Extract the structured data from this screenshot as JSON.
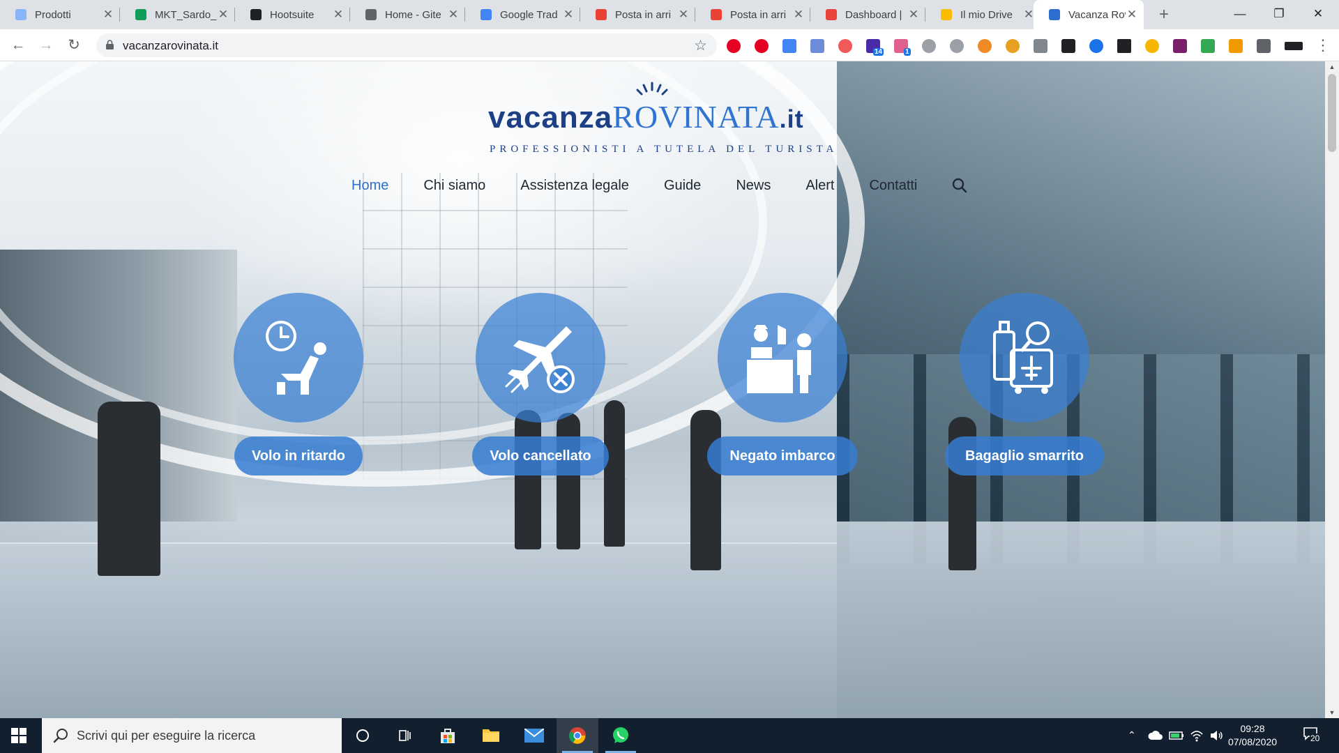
{
  "browser": {
    "tabs": [
      {
        "title": "Prodotti",
        "favicon_color": "#8ab4f8",
        "active": false
      },
      {
        "title": "MKT_Sardo_",
        "favicon_color": "#0f9d58",
        "active": false
      },
      {
        "title": "Hootsuite",
        "favicon_color": "#202124",
        "active": false
      },
      {
        "title": "Home - Gite",
        "favicon_color": "#5f6368",
        "active": false
      },
      {
        "title": "Google Trad",
        "favicon_color": "#4285f4",
        "active": false
      },
      {
        "title": "Posta in arri",
        "favicon_color": "#ea4335",
        "active": false
      },
      {
        "title": "Posta in arri",
        "favicon_color": "#ea4335",
        "active": false
      },
      {
        "title": "Dashboard |",
        "favicon_color": "#e8453c",
        "active": false
      },
      {
        "title": "Il mio Drive",
        "favicon_color": "#fbbc04",
        "active": false
      },
      {
        "title": "Vacanza Rov",
        "favicon_color": "#2d6ecf",
        "active": true
      }
    ],
    "url": "vacanzarovinata.it",
    "extension_badges": [
      "14",
      "1"
    ]
  },
  "site": {
    "logo": {
      "part1": "vacanza",
      "part2": "ROVINATA",
      "part3": ".it",
      "tagline": "PROFESSIONISTI A TUTELA DEL TURISTA"
    },
    "nav": [
      {
        "label": "Home",
        "active": true
      },
      {
        "label": "Chi siamo",
        "active": false
      },
      {
        "label": "Assistenza legale",
        "active": false
      },
      {
        "label": "Guide",
        "active": false
      },
      {
        "label": "News",
        "active": false
      },
      {
        "label": "Alert",
        "active": false
      },
      {
        "label": "Contatti",
        "active": false
      }
    ],
    "services": [
      {
        "label": "Volo in ritardo",
        "icon": "flight-delay-icon"
      },
      {
        "label": "Volo cancellato",
        "icon": "flight-cancelled-icon"
      },
      {
        "label": "Negato imbarco",
        "icon": "denied-boarding-icon"
      },
      {
        "label": "Bagaglio smarrito",
        "icon": "lost-luggage-icon"
      }
    ],
    "accent_color": "#2d6ecf",
    "brand_color": "#1c3f86"
  },
  "taskbar": {
    "search_placeholder": "Scrivi qui per eseguire la ricerca",
    "time": "09:28",
    "date": "07/08/2020",
    "notifications": "20"
  }
}
